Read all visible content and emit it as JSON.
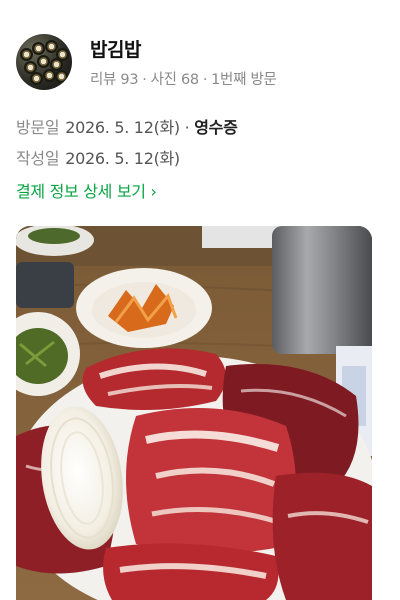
{
  "author": {
    "nickname": "밥김밥",
    "review_count": "리뷰 93",
    "photo_count": "사진 68",
    "visit_order": "1번째 방문",
    "separator": "·"
  },
  "visit": {
    "label": "방문일",
    "date": "2026. 5. 12(화)",
    "separator": "·",
    "receipt_label": "영수증"
  },
  "written": {
    "label": "작성일",
    "date": "2026. 5. 12(화)"
  },
  "payment_link": {
    "label": "결제 정보 상세 보기",
    "chevron": "›"
  },
  "colors": {
    "accent_green": "#08a544",
    "muted_text": "#8a8a8a"
  }
}
